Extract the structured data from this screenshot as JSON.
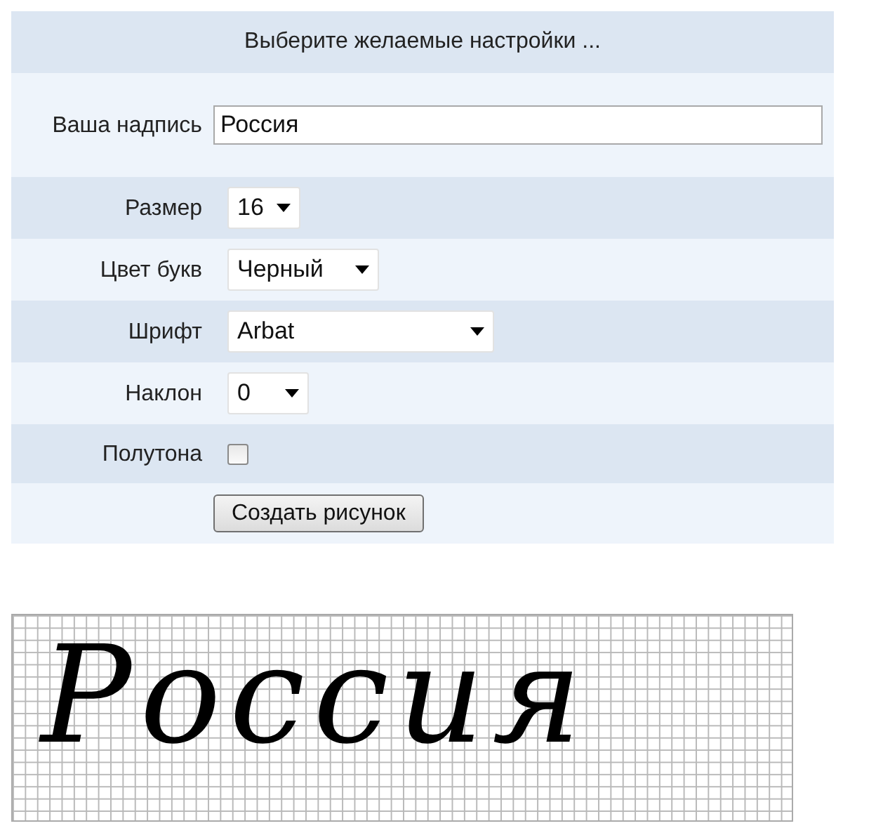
{
  "form": {
    "title": "Выберите желаемые настройки ...",
    "fields": [
      {
        "kind": "text",
        "label": "Ваша надпись",
        "value": "Россия"
      },
      {
        "kind": "select",
        "label": "Размер",
        "value": "16"
      },
      {
        "kind": "select",
        "label": "Цвет букв",
        "value": "Черный"
      },
      {
        "kind": "select",
        "label": "Шрифт",
        "value": "Arbat"
      },
      {
        "kind": "select",
        "label": "Наклон",
        "value": "0"
      },
      {
        "kind": "checkbox",
        "label": "Полутона",
        "checked": false
      }
    ],
    "button": "Создать рисунок"
  },
  "pattern": {
    "text": "Россия"
  }
}
